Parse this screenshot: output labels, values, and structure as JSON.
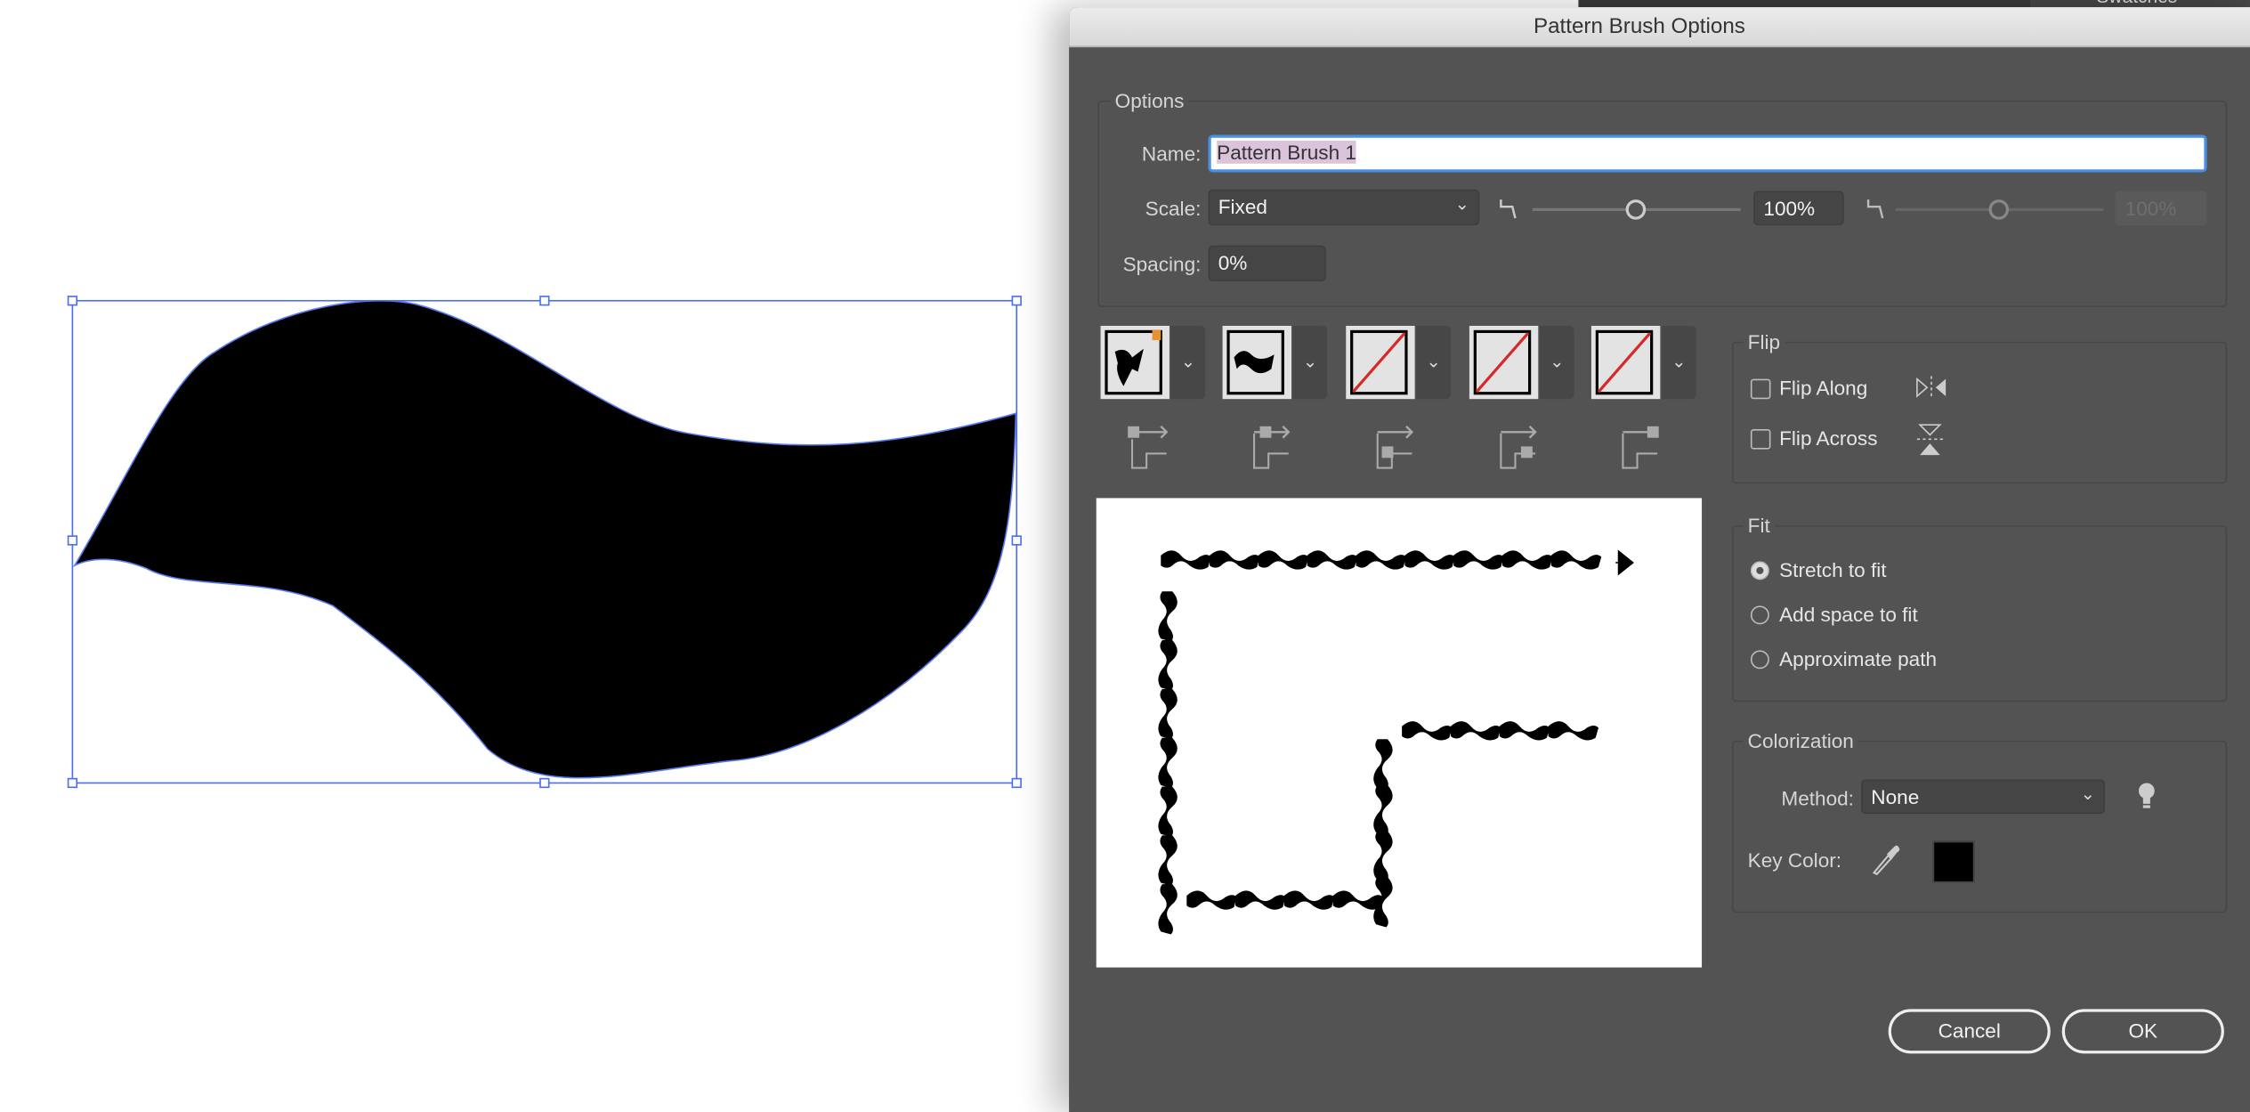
{
  "panel": {
    "swatches_tab": "Swatches"
  },
  "dialog": {
    "title": "Pattern Brush Options",
    "options": {
      "group_label": "Options",
      "name_label": "Name:",
      "name_value": "Pattern Brush 1",
      "scale_label": "Scale:",
      "scale_value": "Fixed",
      "scale_percent": "100%",
      "scale_slider_percent": 100,
      "scale_max_percent": "100%",
      "spacing_label": "Spacing:",
      "spacing_value": "0%"
    },
    "tiles": [
      {
        "name": "side-tile",
        "content": "leaf"
      },
      {
        "name": "outer-corner-tile",
        "content": "wave"
      },
      {
        "name": "inner-corner-tile",
        "content": "none"
      },
      {
        "name": "start-tile",
        "content": "none"
      },
      {
        "name": "end-tile",
        "content": "none"
      }
    ],
    "flip": {
      "group_label": "Flip",
      "along_label": "Flip Along",
      "along_checked": false,
      "across_label": "Flip Across",
      "across_checked": false
    },
    "fit": {
      "group_label": "Fit",
      "options": [
        "Stretch to fit",
        "Add space to fit",
        "Approximate path"
      ],
      "selected": "Stretch to fit"
    },
    "colorization": {
      "group_label": "Colorization",
      "method_label": "Method:",
      "method_value": "None",
      "key_color_label": "Key Color:",
      "key_color": "#000000"
    },
    "buttons": {
      "cancel": "Cancel",
      "ok": "OK"
    }
  },
  "colors": {
    "accent": "#4a90e2",
    "selection_box": "#4a6cf7",
    "tile_none": "#d42a2a",
    "corner_marker": "#e8922f"
  }
}
